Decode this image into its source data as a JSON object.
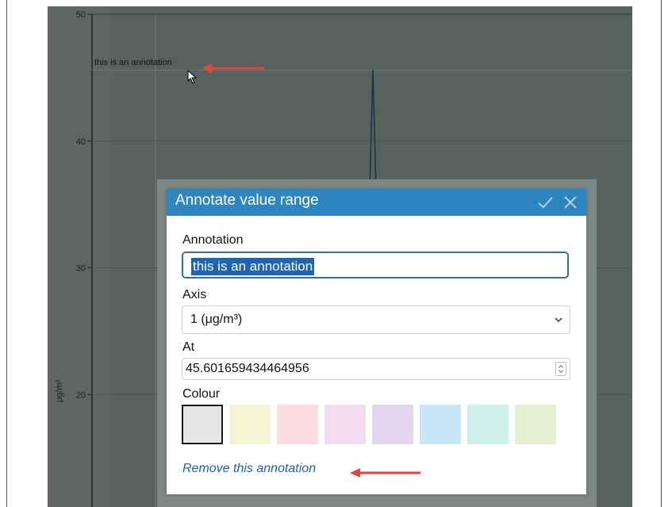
{
  "chart_data": {
    "type": "line",
    "ylabel": "μg/m³",
    "ylim": [
      10,
      50
    ],
    "y_ticks": [
      "50",
      "40",
      "30",
      "20"
    ],
    "annotation_line_at": 45.6,
    "annotation_label": "this is an annotation",
    "peak_value": 45.6
  },
  "dialog": {
    "title": "Annotate value range",
    "annotation_label": "Annotation",
    "annotation_value": "this is an annotation",
    "axis_label": "Axis",
    "axis_value": "1 (μg/m³)",
    "at_label": "At",
    "at_value": "45.601659434464956",
    "colour_label": "Colour",
    "colours": [
      "#e6e6e6",
      "#f5f5d6",
      "#fbdde3",
      "#f5dbef",
      "#e3d4f0",
      "#c9e6f6",
      "#cdf0ea",
      "#e5f0d2"
    ],
    "selected_colour_index": 0,
    "remove_link": "Remove this annotation"
  },
  "colors": {
    "header": "#2e86c1",
    "arrow": "#e0463f",
    "link": "#1b5fb5"
  }
}
